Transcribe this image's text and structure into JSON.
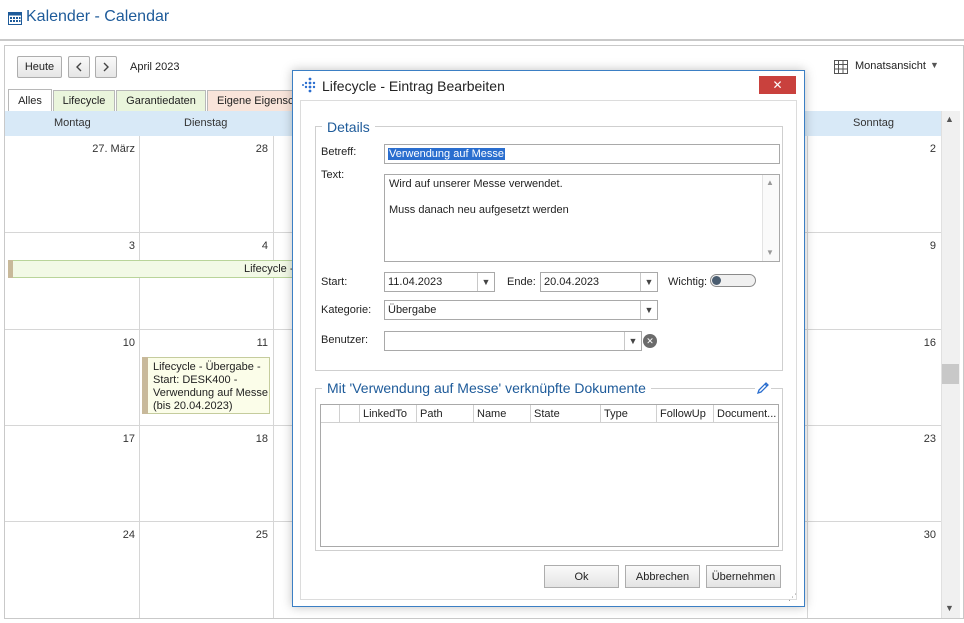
{
  "app": {
    "title": "Kalender - Calendar"
  },
  "toolbar": {
    "today_label": "Heute",
    "prev_icon": "chevron-left-icon",
    "next_icon": "chevron-right-icon",
    "month_label": "April 2023",
    "view_label": "Monatsansicht"
  },
  "tabs": [
    {
      "label": "Alles",
      "active": true
    },
    {
      "label": "Lifecycle",
      "color": "#eaf5dc"
    },
    {
      "label": "Garantiedaten",
      "color": "#eaf5dc"
    },
    {
      "label": "Eigene Eigensch",
      "color": "#f9e4da"
    }
  ],
  "days": {
    "mon": "Montag",
    "tue": "Dienstag",
    "sun": "Sonntag"
  },
  "weeks": [
    {
      "mon": "27. März",
      "tue": "28",
      "sun": "2"
    },
    {
      "mon": "3",
      "tue": "4",
      "sun": "9"
    },
    {
      "mon": "10",
      "tue": "11",
      "sun": "16"
    },
    {
      "mon": "17",
      "tue": "18",
      "sun": "23"
    },
    {
      "mon": "24",
      "tue": "25",
      "sun": "30"
    }
  ],
  "events": {
    "week2_bar_label": "Lifecycle -",
    "card_text": "Lifecycle - Übergabe -\nStart: DESK400 -\nVerwendung auf Messe\n(bis 20.04.2023)"
  },
  "dialog": {
    "title": "Lifecycle - Eintrag Bearbeiten",
    "close_icon": "close-icon",
    "details_legend": "Details",
    "subject_label": "Betreff:",
    "subject_value": "Verwendung auf Messe",
    "text_label": "Text:",
    "text_value": "Wird auf unserer Messe verwendet.\n\nMuss danach neu aufgesetzt werden",
    "start_label": "Start:",
    "start_value": "11.04.2023",
    "end_label": "Ende:",
    "end_value": "20.04.2023",
    "important_label": "Wichtig:",
    "important_value": false,
    "category_label": "Kategorie:",
    "category_value": "Übergabe",
    "user_label": "Benutzer:",
    "user_value": "",
    "docs_legend": "Mit 'Verwendung auf Messe' verknüpfte Dokumente",
    "docs_columns": [
      "",
      "",
      "LinkedTo",
      "Path",
      "Name",
      "State",
      "Type",
      "FollowUp",
      "Document..."
    ],
    "ok_label": "Ok",
    "cancel_label": "Abbrechen",
    "apply_label": "Übernehmen"
  },
  "colors": {
    "accent": "#1e5b9a",
    "header_bg": "#d8e9f7",
    "close": "#c9413d",
    "selection": "#2a6ecf"
  }
}
